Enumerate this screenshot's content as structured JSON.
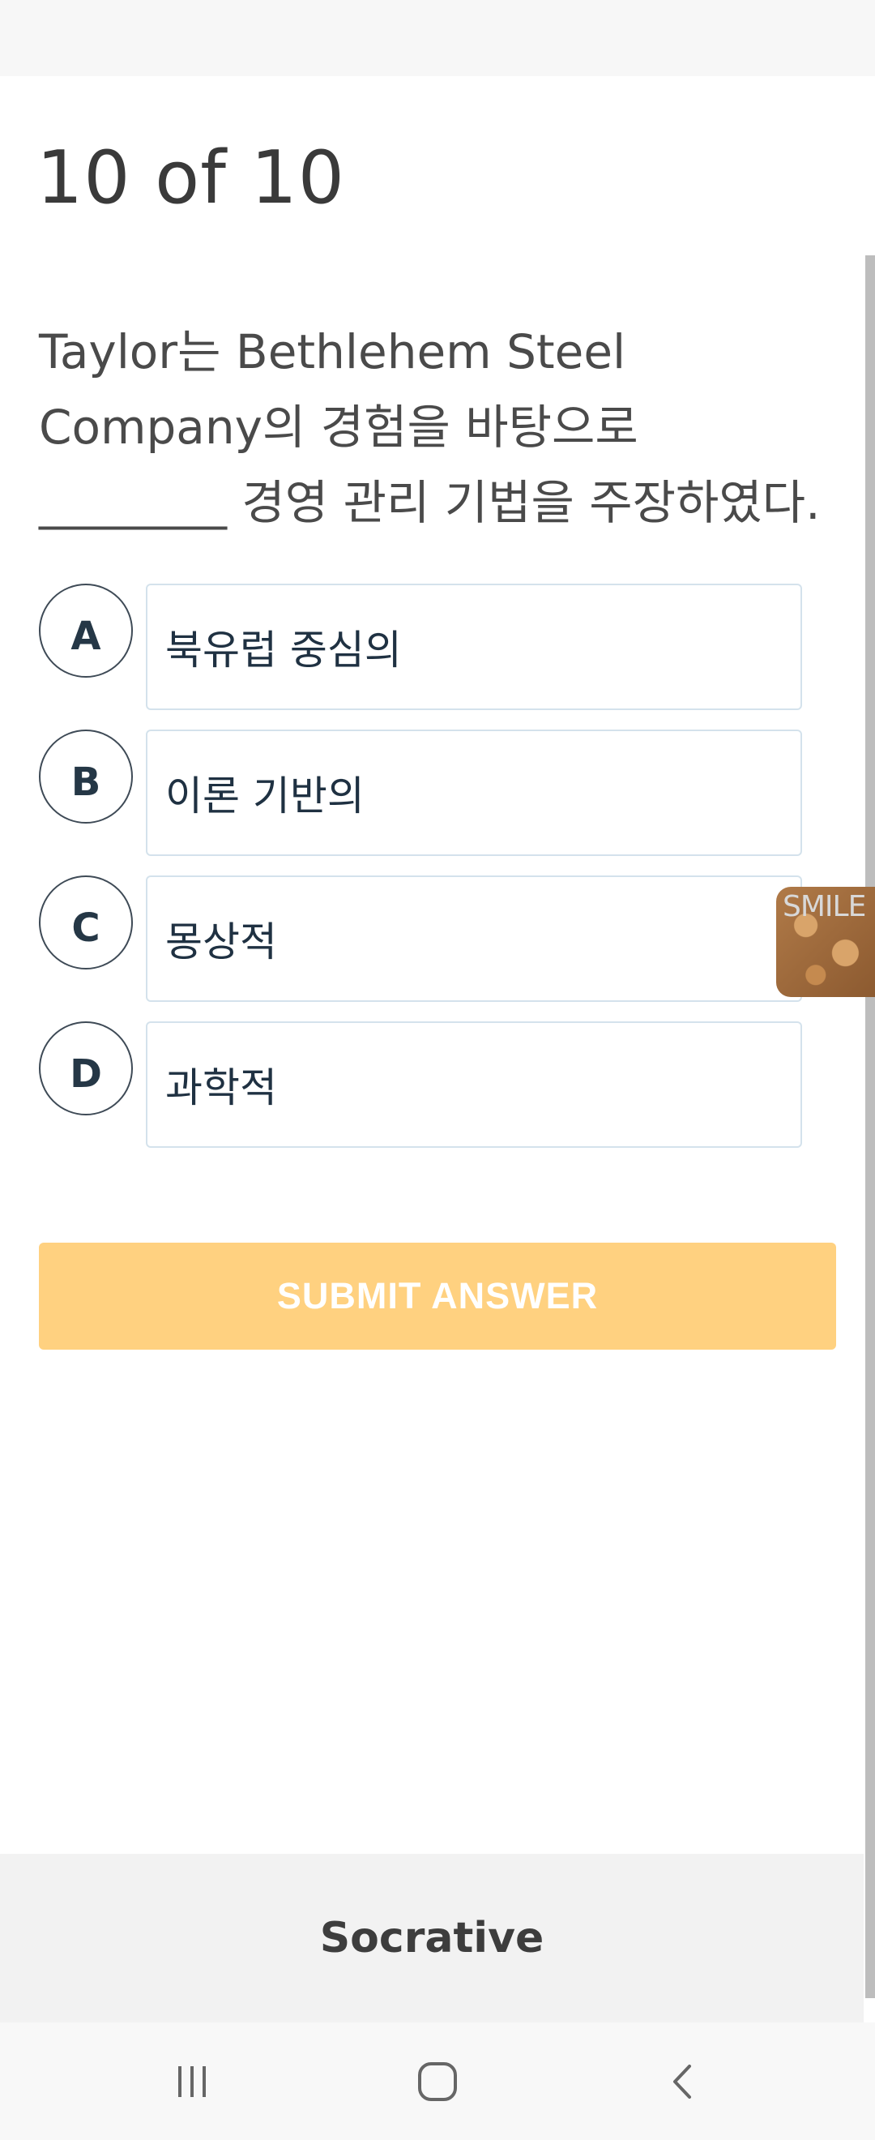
{
  "quiz": {
    "progress": "10 of 10",
    "question": "Taylor는 Bethlehem Steel\nCompany의 경험을 바탕으로\n________ 경영 관리 기법을 주장하였다.",
    "choices": [
      {
        "letter": "A",
        "text": "북유럽 중심의"
      },
      {
        "letter": "B",
        "text": "이론 기반의"
      },
      {
        "letter": "C",
        "text": "몽상적"
      },
      {
        "letter": "D",
        "text": "과학적"
      }
    ],
    "submit_label": "SUBMIT ANSWER"
  },
  "sticker": {
    "text": "SMILE"
  },
  "footer": {
    "brand": "Socrative"
  },
  "nav": {
    "icons": [
      "recent-apps-icon",
      "home-icon",
      "back-icon"
    ]
  },
  "colors": {
    "submit_button": "#ffd180",
    "choice_border": "#d4e2ec",
    "footer_bg": "#f2f2f2"
  }
}
